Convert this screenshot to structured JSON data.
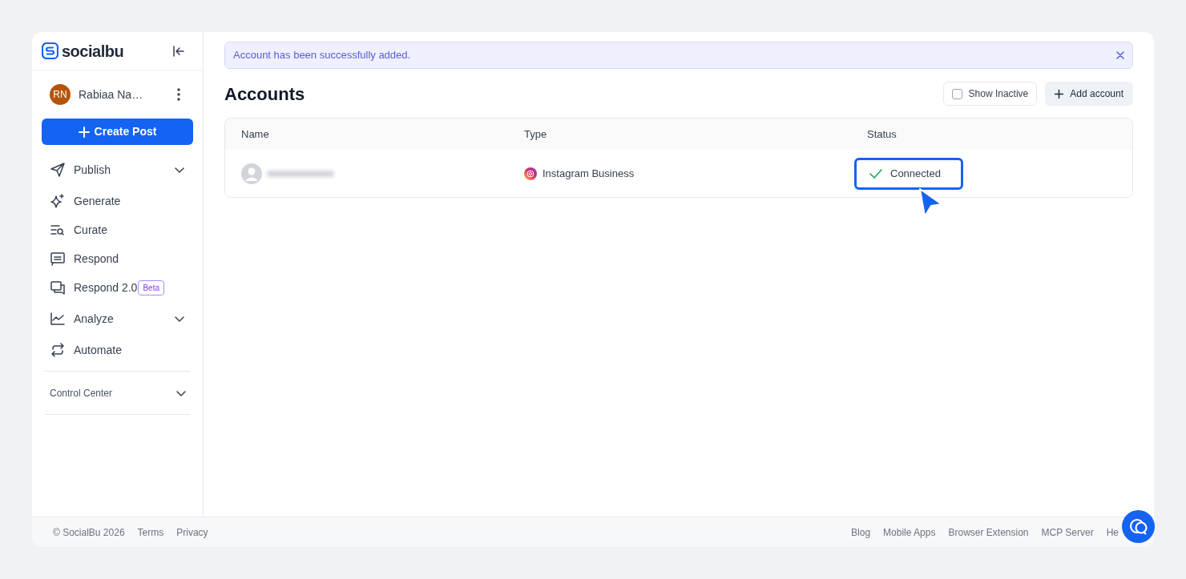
{
  "brand": {
    "name": "socialbu"
  },
  "user": {
    "initials": "RN",
    "name": "Rabiaa Na…"
  },
  "create_button": {
    "label": "Create Post"
  },
  "nav": [
    {
      "label": "Publish",
      "expandable": true
    },
    {
      "label": "Generate",
      "expandable": false
    },
    {
      "label": "Curate",
      "expandable": false
    },
    {
      "label": "Respond",
      "expandable": false
    },
    {
      "label": "Respond 2.0",
      "expandable": false,
      "badge": "Beta"
    },
    {
      "label": "Analyze",
      "expandable": true
    },
    {
      "label": "Automate",
      "expandable": false
    }
  ],
  "sections": [
    {
      "label": "Control Center",
      "expandable": true
    }
  ],
  "alert": {
    "text": "Account has been successfully added."
  },
  "page_title": "Accounts",
  "show_inactive": {
    "label": "Show Inactive",
    "checked": false
  },
  "add_button": {
    "label": "Add account"
  },
  "table": {
    "columns": [
      "Name",
      "Type",
      "Status"
    ],
    "rows": [
      {
        "type": "Instagram Business",
        "status": "Connected",
        "highlighted": true
      }
    ]
  },
  "footer": {
    "left": [
      "© SocialBu 2026",
      "Terms",
      "Privacy"
    ],
    "right": [
      "Blog",
      "Mobile Apps",
      "Browser Extension",
      "MCP Server",
      "He"
    ]
  }
}
